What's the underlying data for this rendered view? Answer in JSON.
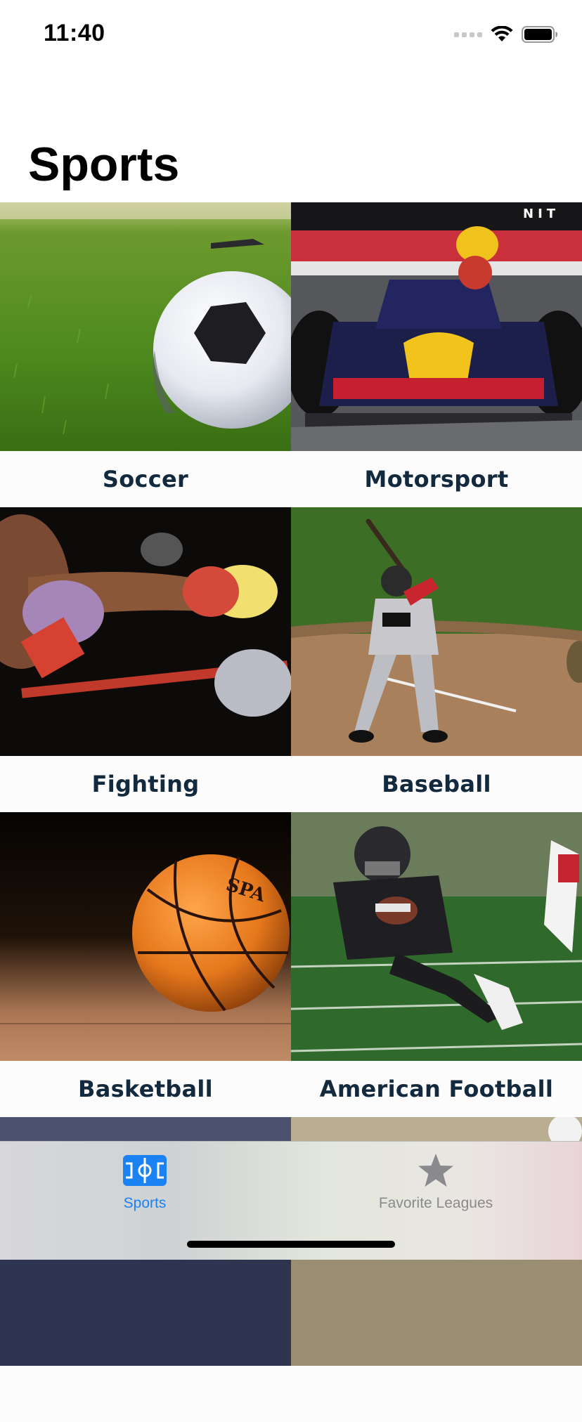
{
  "status_bar": {
    "time": "11:40"
  },
  "page": {
    "title": "Sports"
  },
  "sports": [
    {
      "label": "Soccer",
      "image": "soccer-ball-on-grass"
    },
    {
      "label": "Motorsport",
      "image": "formula-one-car"
    },
    {
      "label": "Fighting",
      "image": "boxing-punch"
    },
    {
      "label": "Baseball",
      "image": "baseball-batter"
    },
    {
      "label": "Basketball",
      "image": "basketball-on-court"
    },
    {
      "label": "American Football",
      "image": "football-runner"
    }
  ],
  "tab_bar": {
    "tabs": [
      {
        "label": "Sports",
        "icon": "field-icon",
        "selected": true,
        "color": "#1a82f2"
      },
      {
        "label": "Favorite Leagues",
        "icon": "star-icon",
        "selected": false,
        "color": "#8a8a8e"
      }
    ]
  },
  "colors": {
    "label_text": "#13293d",
    "accent": "#1a82f2"
  }
}
